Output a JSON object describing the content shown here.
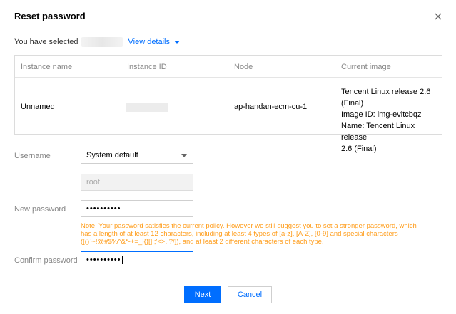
{
  "dialog": {
    "title": "Reset password",
    "close_icon": "close-icon"
  },
  "selection": {
    "prefix": "You have selected",
    "view_details": "View details"
  },
  "table": {
    "headers": [
      "Instance name",
      "Instance ID",
      "Node",
      "Current image"
    ],
    "row": {
      "instance_name": "Unnamed",
      "node": "ap-handan-ecm-cu-1",
      "current_image": [
        "Tencent Linux release 2.6 (Final)",
        "Image ID: img-evitcbqz",
        "Name: Tencent Linux release",
        "2.6 (Final)"
      ]
    }
  },
  "form": {
    "username_label": "Username",
    "username_select": "System default",
    "username_value": "root",
    "new_password_label": "New password",
    "new_password_value": "••••••••••",
    "note": "Note: Your password satisfies the current policy. However we still suggest you to set a stronger password, which has a length of at least 12 characters, including at least 4 types of [a-z], [A-Z], [0-9] and special characters ([()`~!@#$%^&*-+=_|{}[]:;'<>,.?/]), and at least 2 different characters of each type.",
    "confirm_password_label": "Confirm password",
    "confirm_password_value": "••••••••••"
  },
  "buttons": {
    "next": "Next",
    "cancel": "Cancel"
  },
  "colors": {
    "accent": "#006eff",
    "warning": "#ff9c19"
  }
}
